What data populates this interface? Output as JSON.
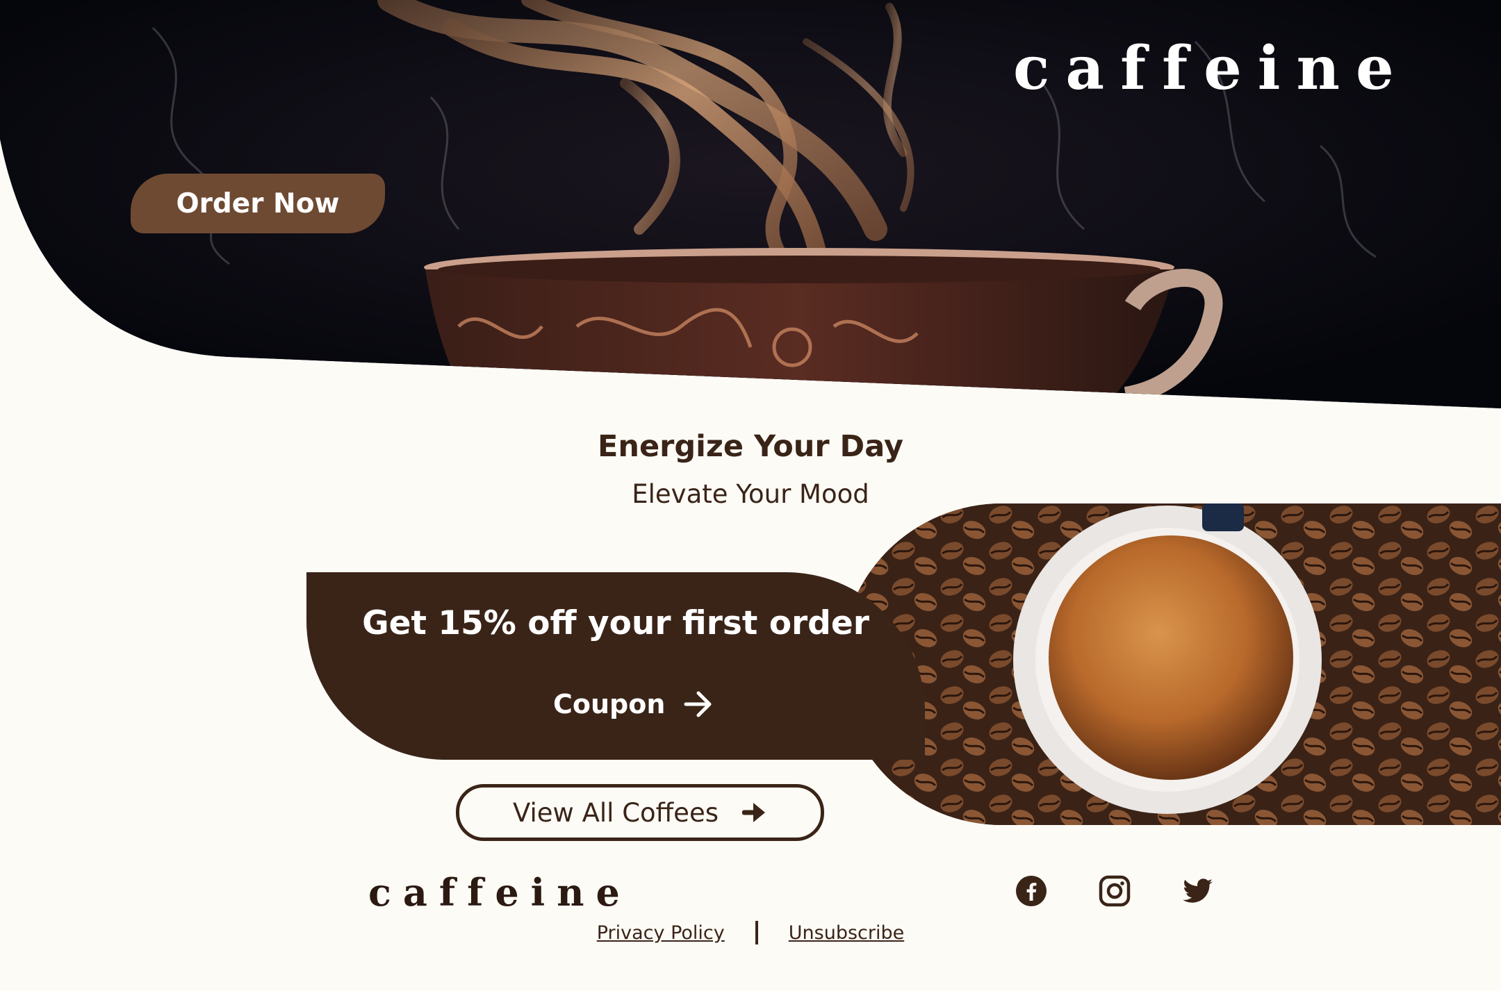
{
  "hero": {
    "brand": "caffeine",
    "order_button": "Order Now"
  },
  "headline": {
    "title": "Energize Your Day",
    "subtitle": "Elevate Your Mood"
  },
  "promo": {
    "title": "Get 15% off your first order",
    "coupon_label": "Coupon"
  },
  "view_all_label": "View All Coffees",
  "footer": {
    "brand": "caffeine",
    "social": [
      "facebook-icon",
      "instagram-icon",
      "twitter-icon"
    ],
    "privacy_label": "Privacy Policy",
    "unsubscribe_label": "Unsubscribe"
  },
  "colors": {
    "brown_dark": "#3a2418",
    "brown_button": "#6e4a33",
    "background": "#fdfbf6",
    "hero_bg": "#06070f"
  }
}
